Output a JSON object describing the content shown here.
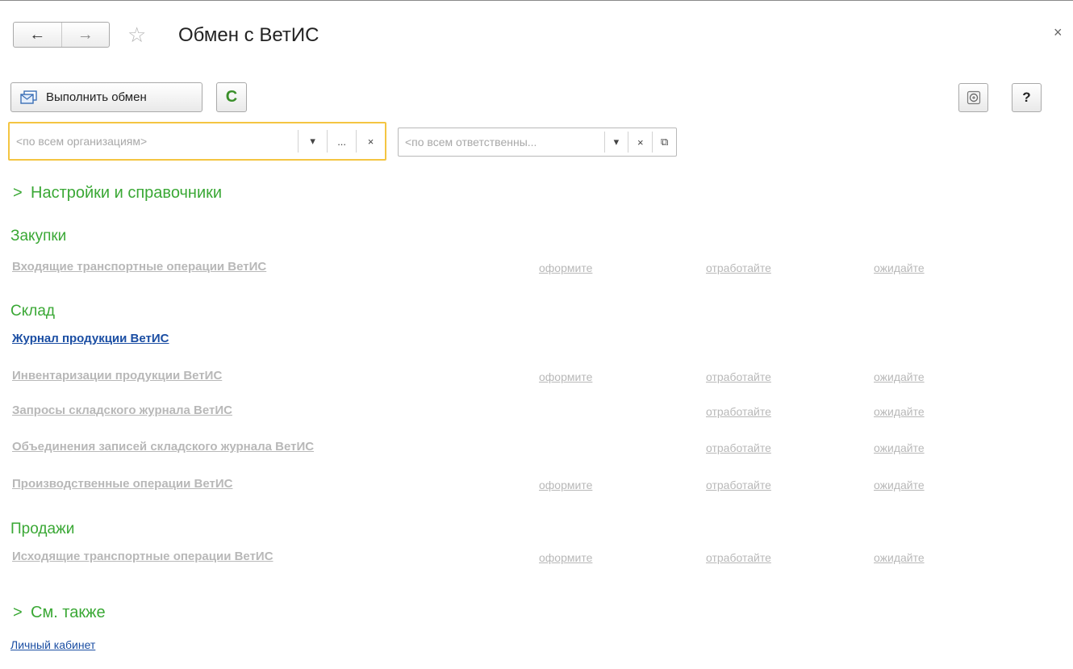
{
  "window": {
    "title": "Обмен с ВетИС",
    "back_icon": "←",
    "forward_icon": "→",
    "star_icon": "☆",
    "close_icon": "×"
  },
  "toolbar": {
    "exchange_label": "Выполнить обмен",
    "refresh_icon": "C",
    "help_label": "?"
  },
  "filters": {
    "organization": {
      "value": "",
      "placeholder": "<по всем организациям>",
      "dropdown_icon": "▾",
      "choose_icon": "...",
      "clear_icon": "×"
    },
    "responsible": {
      "value": "",
      "placeholder": "<по всем ответственны...",
      "dropdown_icon": "▾",
      "clear_icon": "×",
      "open_icon": "⧉"
    }
  },
  "sections": {
    "settings_label": "Настройки и справочники",
    "see_also_label": "См. также",
    "chevron": ">"
  },
  "groups": {
    "purchases": {
      "title": "Закупки",
      "rows": [
        {
          "label": "Входящие транспортные операции ВетИС",
          "c1": "оформите",
          "c2": "отработайте",
          "c3": "ожидайте"
        }
      ]
    },
    "warehouse": {
      "title": "Склад",
      "journal": "Журнал продукции ВетИС",
      "rows": [
        {
          "label": "Инвентаризации продукции ВетИС",
          "c1": "оформите",
          "c2": "отработайте",
          "c3": "ожидайте"
        },
        {
          "label": "Запросы складского журнала ВетИС",
          "c2": "отработайте",
          "c3": "ожидайте"
        },
        {
          "label": "Объединения записей складского журнала ВетИС",
          "c2": "отработайте",
          "c3": "ожидайте"
        },
        {
          "label": "Производственные операции ВетИС",
          "c1": "оформите",
          "c2": "отработайте",
          "c3": "ожидайте"
        }
      ]
    },
    "sales": {
      "title": "Продажи",
      "rows": [
        {
          "label": "Исходящие транспортные операции ВетИС",
          "c1": "оформите",
          "c2": "отработайте",
          "c3": "ожидайте"
        }
      ]
    }
  },
  "see_also": {
    "cabinet_link": "Личный кабинет"
  }
}
